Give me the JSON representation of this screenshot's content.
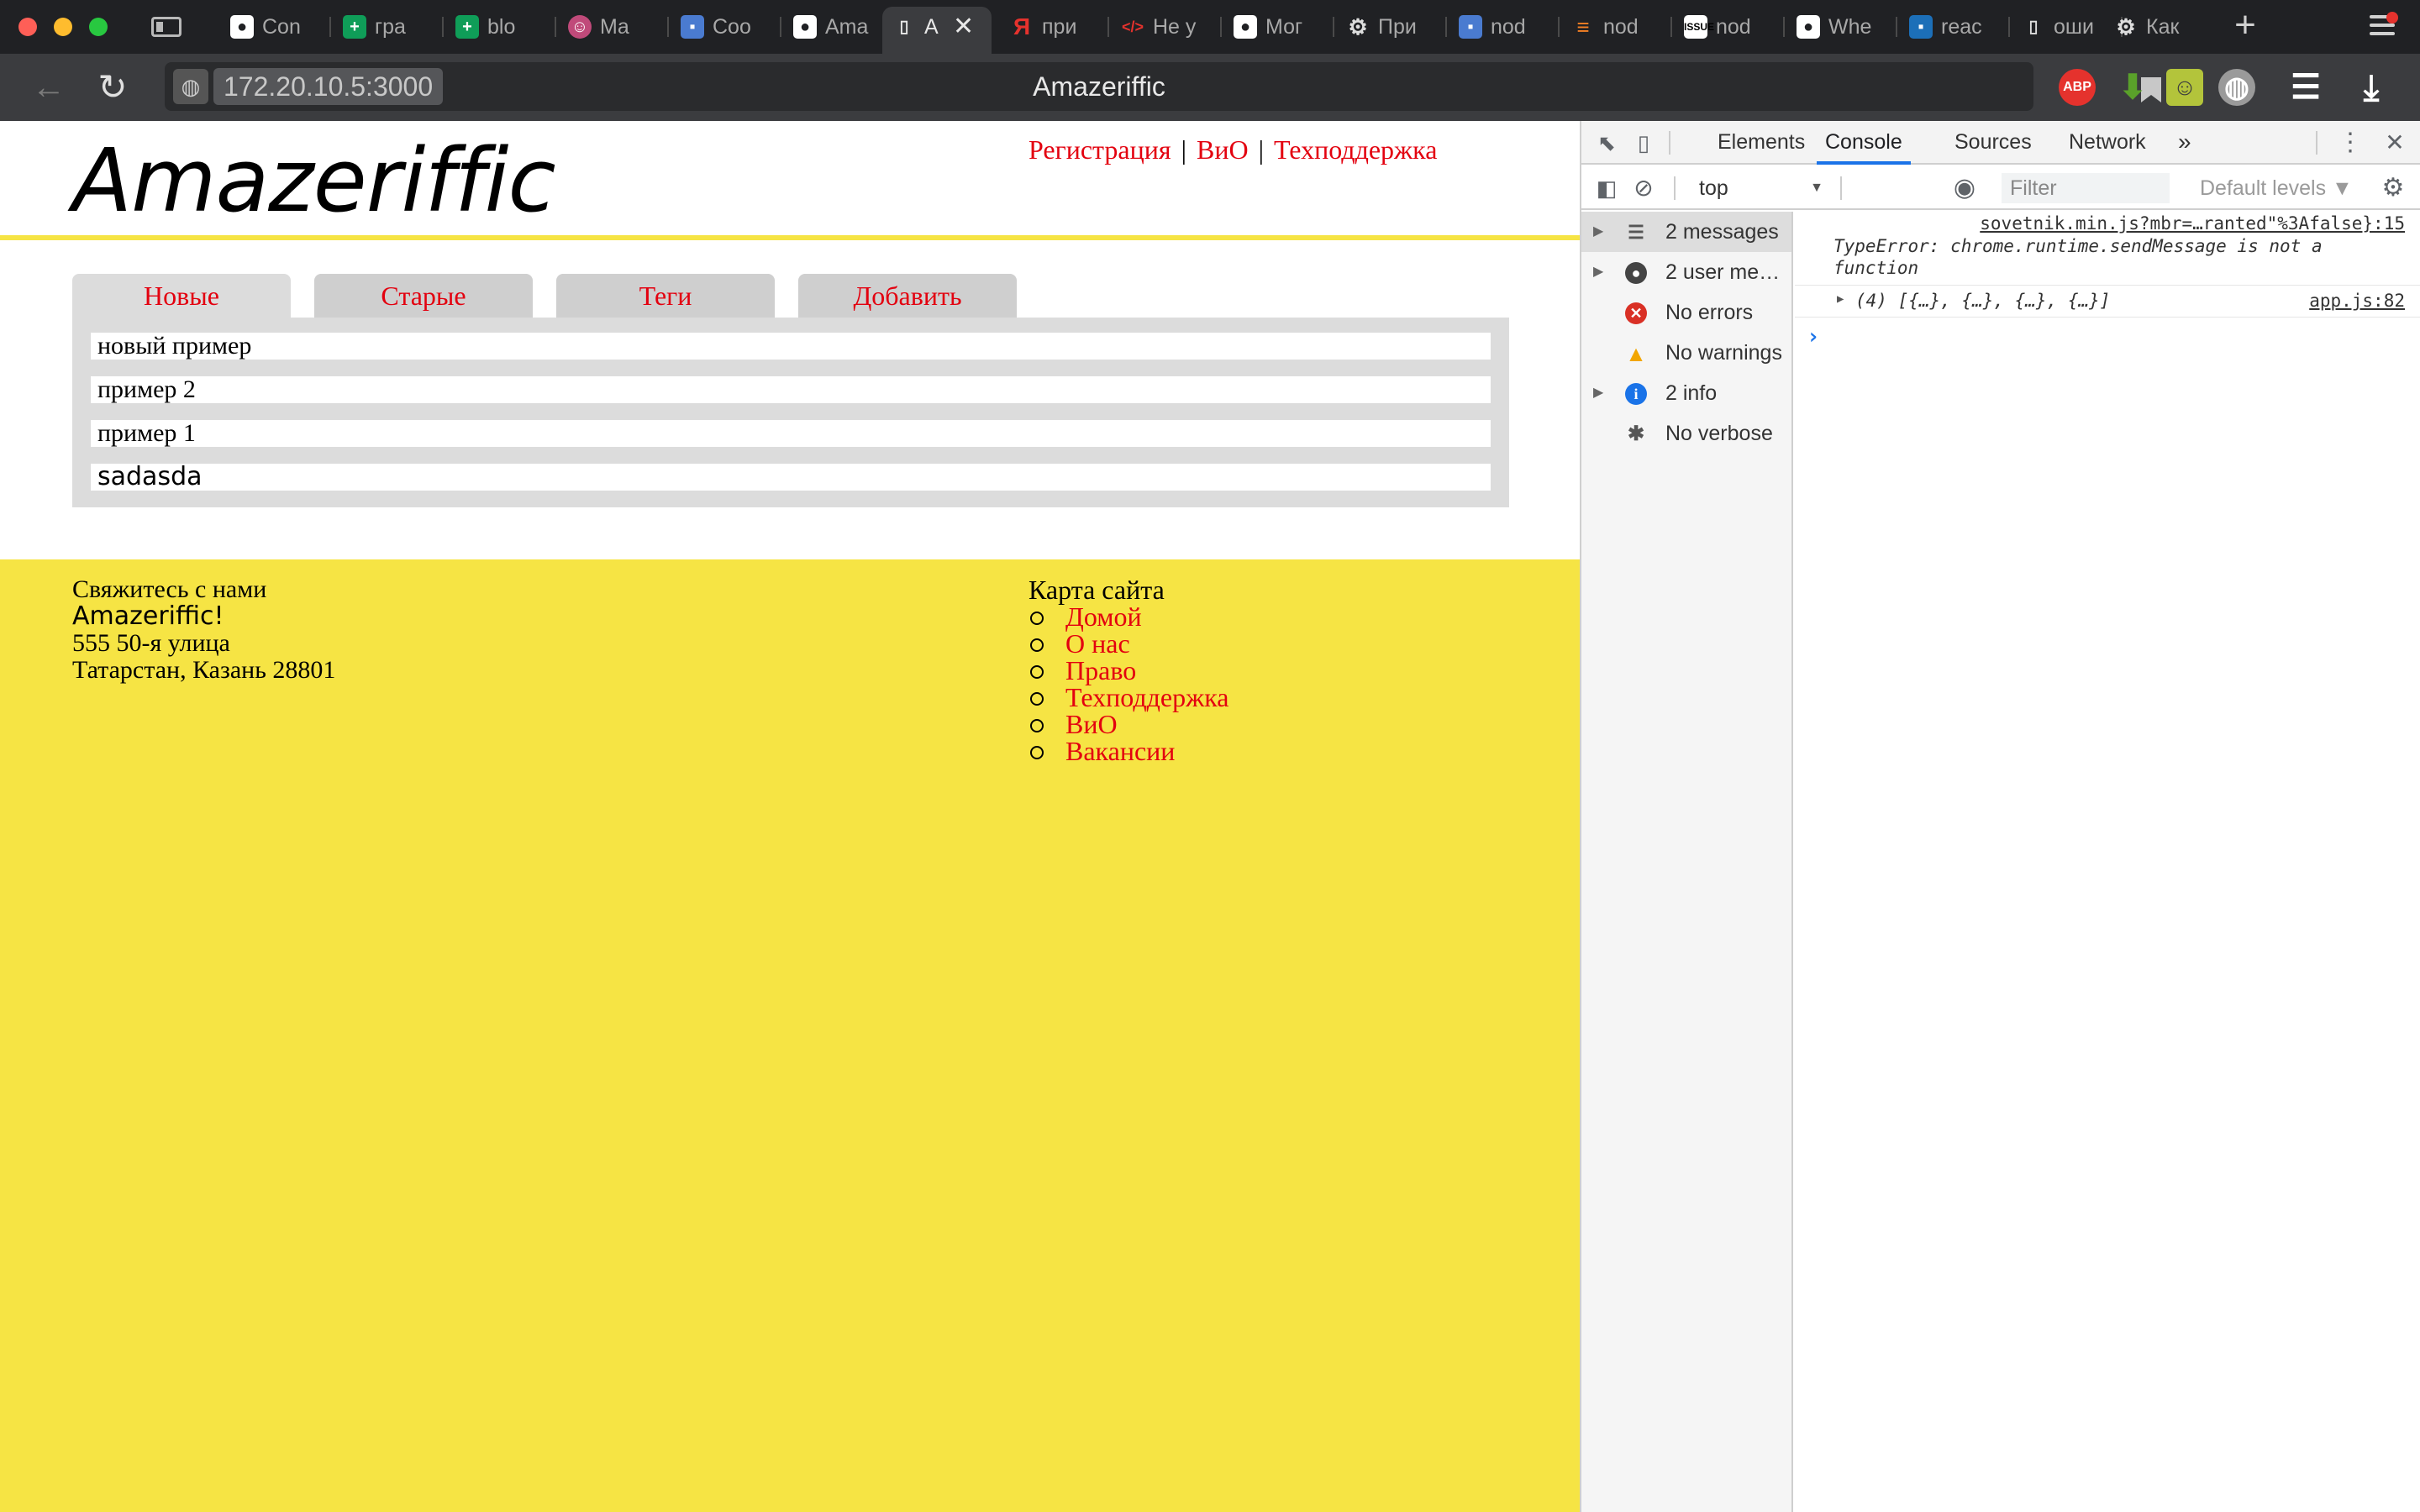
{
  "browser": {
    "tabs": [
      {
        "title": "Con",
        "favicon": "github-icon",
        "color": "#202124"
      },
      {
        "title": "гра",
        "favicon": "sheets-icon",
        "color": "#0f9d58"
      },
      {
        "title": "blo",
        "favicon": "sheets-icon",
        "color": "#0f9d58"
      },
      {
        "title": "Ma",
        "favicon": "avatar-icon",
        "color": "#c04a7a"
      },
      {
        "title": "Coo",
        "favicon": "chat-icon",
        "color": "#4a7bd0"
      },
      {
        "title": "Ama",
        "favicon": "github-icon",
        "color": "#202124"
      },
      {
        "title": "A",
        "favicon": "document-icon",
        "color": "#3b3c3f"
      },
      {
        "title": "при",
        "favicon": "yandex-icon",
        "color": "#202124"
      },
      {
        "title": "Не у",
        "favicon": "code-icon",
        "color": "#202124"
      },
      {
        "title": "Мог",
        "favicon": "github-icon",
        "color": "#202124"
      },
      {
        "title": "При",
        "favicon": "gear-icon",
        "color": "#202124"
      },
      {
        "title": "nod",
        "favicon": "translate-icon",
        "color": "#202124"
      },
      {
        "title": "nod",
        "favicon": "stackoverflow-icon",
        "color": "#202124"
      },
      {
        "title": "nod",
        "favicon": "issue-icon",
        "color": "#202124"
      },
      {
        "title": "Whe",
        "favicon": "github-icon",
        "color": "#202124"
      },
      {
        "title": "reac",
        "favicon": "blog-icon",
        "color": "#202124"
      },
      {
        "title": "оши",
        "favicon": "document-icon",
        "color": "#202124"
      },
      {
        "title": "Как",
        "favicon": "gear-icon",
        "color": "#202124"
      }
    ],
    "active_tab_index": 6,
    "url": "172.20.10.5:3000",
    "page_title": "Amazeriffic",
    "extensions": [
      {
        "name": "adblock-icon",
        "label": "ABP",
        "color": "#e5322d"
      },
      {
        "name": "download-helper-icon",
        "label": "⬇",
        "color": "#5aa12a"
      },
      {
        "name": "extension-face-icon",
        "label": "☺",
        "color": "#b3c43b"
      },
      {
        "name": "globe-extension-icon",
        "label": "◍",
        "color": "#9a9a9a"
      },
      {
        "name": "feedback-icon",
        "label": "☰",
        "color": "#3b3c3f"
      },
      {
        "name": "download-icon",
        "label": "⤓",
        "color": "#3b3c3f"
      }
    ]
  },
  "site": {
    "logo": "Amazeriffic",
    "nav": [
      "Регистрация",
      "ВиО",
      "Техподдержка"
    ],
    "nav_separator": "|",
    "tabs": [
      "Новые",
      "Старые",
      "Теги",
      "Добавить"
    ],
    "active_tab": 0,
    "items": [
      "новый пример",
      "пример 2",
      "пример 1",
      "sadasda"
    ],
    "footer": {
      "contact_heading": "Свяжитесь с нами",
      "company": "Amazeriffic!",
      "address_line1": "555 50-я улица",
      "address_line2": "Татарстан, Казань 28801",
      "sitemap_heading": "Карта сайта",
      "sitemap_links": [
        "Домой",
        "О нас",
        "Право",
        "Техподдержка",
        "ВиО",
        "Вакансии"
      ]
    }
  },
  "devtools": {
    "tabs": [
      "Elements",
      "Console",
      "Sources",
      "Network"
    ],
    "active_tab": "Console",
    "more_tabs": "»",
    "context": "top",
    "filter_placeholder": "Filter",
    "levels": "Default levels ▼",
    "sidebar": [
      {
        "label": "2 messages",
        "icon": "list-icon",
        "expandable": true
      },
      {
        "label": "2 user mes…",
        "icon": "user-icon",
        "expandable": true
      },
      {
        "label": "No errors",
        "icon": "error-icon",
        "expandable": false
      },
      {
        "label": "No warnings",
        "icon": "warning-icon",
        "expandable": false
      },
      {
        "label": "2 info",
        "icon": "info-icon",
        "expandable": true
      },
      {
        "label": "No verbose",
        "icon": "bug-icon",
        "expandable": false
      }
    ],
    "console": [
      {
        "source": "sovetnik.min.js?mbr=…ranted\"%3Afalse}:15",
        "text": "TypeError: chrome.runtime.sendMessage is not a function"
      },
      {
        "source": "app.js:82",
        "text": "(4) [{…}, {…}, {…}, {…}]"
      }
    ]
  },
  "colors": {
    "accent_red": "#e3000f",
    "footer_yellow": "#f6e444",
    "panel_grey": "#dcdcdc"
  }
}
